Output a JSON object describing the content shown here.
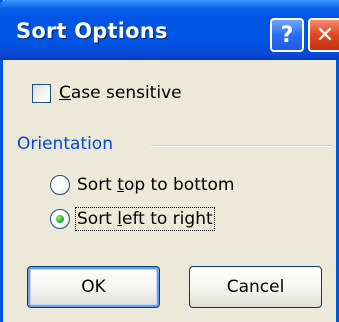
{
  "window": {
    "title": "Sort Options",
    "help_symbol": "?",
    "close_symbol": "✕"
  },
  "options": {
    "case_sensitive": {
      "label": "Case sensitive",
      "mnemonic": "C",
      "rest": "ase sensitive",
      "checked": false
    }
  },
  "orientation": {
    "title": "Orientation",
    "choices": [
      {
        "label": "Sort top to bottom",
        "prefix": "Sort ",
        "mnemonic": "t",
        "rest": "op to bottom",
        "selected": false
      },
      {
        "label": "Sort left to right",
        "prefix": "Sort ",
        "mnemonic": "l",
        "rest": "eft to right",
        "selected": true
      }
    ]
  },
  "buttons": {
    "ok_label": "OK",
    "cancel_label": "Cancel"
  },
  "colors": {
    "titlebar": "#0055e5",
    "dialog_bg": "#ece9d8",
    "group_title": "#0046d5",
    "close_button": "#e0481e"
  }
}
